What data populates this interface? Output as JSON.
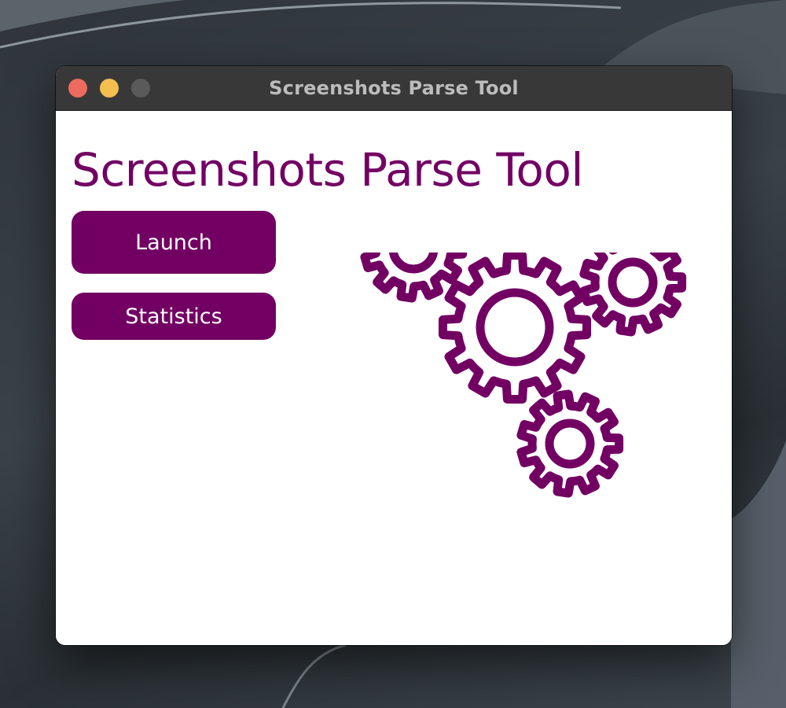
{
  "window": {
    "title": "Screenshots Parse Tool",
    "controls": [
      "close",
      "minimize",
      "zoom"
    ]
  },
  "main": {
    "heading": "Screenshots Parse Tool",
    "buttons": {
      "launch_label": "Launch",
      "statistics_label": "Statistics"
    },
    "illustration": "gears-icon"
  },
  "colors": {
    "accent": "#720063",
    "titlebar": "#383838",
    "close": "#ec6a5e",
    "minimize": "#f4bf4f",
    "zoom": "#5a5a5a"
  }
}
